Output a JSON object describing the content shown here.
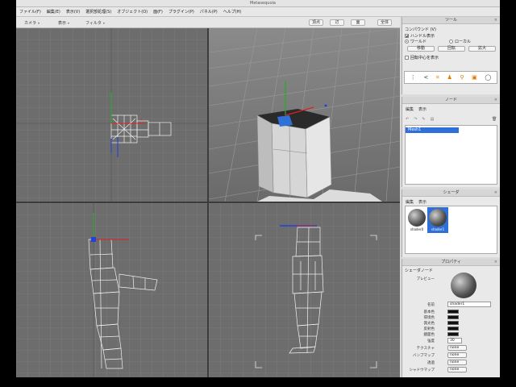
{
  "window": {
    "title": "Metasequoia"
  },
  "menu": [
    "ファイル(F)",
    "編集(E)",
    "表示(V)",
    "選択部処理(S)",
    "オブジェクト(O)",
    "面(F)",
    "プラグイン(P)",
    "パネル(P)",
    "ヘルプ(H)"
  ],
  "toolbar": {
    "view_select": "カメラ",
    "display_select": "表示",
    "filter_select": "フィルタ",
    "btn1": "頂点",
    "btn2": "辺",
    "btn3": "面",
    "btn4": "全体"
  },
  "tool_panel": {
    "title": "ツール",
    "subtitle": "コンパウンド (V)",
    "handle_label": "ハンドル表示",
    "world_label": "ワールド",
    "local_label": "ローカル",
    "move_btn": "移動",
    "rotate_btn": "回転",
    "scale_btn": "拡大",
    "pivot_label": "回転中心を表示",
    "icons": [
      "cursor-icon",
      "share-icon",
      "transform-icon",
      "figure-icon",
      "bone-icon",
      "highlight-icon",
      "lasso-icon"
    ]
  },
  "node_panel": {
    "title": "ノード",
    "tab_edit": "編集",
    "tab_view": "表示",
    "selected_item": "Mesh1"
  },
  "shader_panel": {
    "title": "シェーダ",
    "tab_edit": "編集",
    "tab_view": "表示",
    "items": [
      {
        "label": "shader0"
      },
      {
        "label": "shader1"
      }
    ]
  },
  "property_panel": {
    "title": "プロパティ",
    "section": "シェーダノード",
    "preview_label": "プレビュー",
    "name_label": "名前",
    "name_value": "shader1",
    "color_labels": [
      "基本色",
      "環境色",
      "発光色",
      "反射色",
      "鏡面色"
    ],
    "value_label": "強度",
    "value": "30",
    "texture_label": "テクスチャ",
    "texture_value": "none",
    "bump_label": "バンプマップ",
    "bump_value": "none",
    "alpha_label": "透過",
    "alpha_value": "none",
    "env_label": "シャドウマップ",
    "env_value": "none"
  },
  "colors": {
    "viewport_bg": "#6d6d6d",
    "grid": "#8a8a8a",
    "selection": "#2f6fd8",
    "axis_x": "#e02020",
    "axis_y": "#20b020",
    "axis_z": "#2040e0"
  }
}
